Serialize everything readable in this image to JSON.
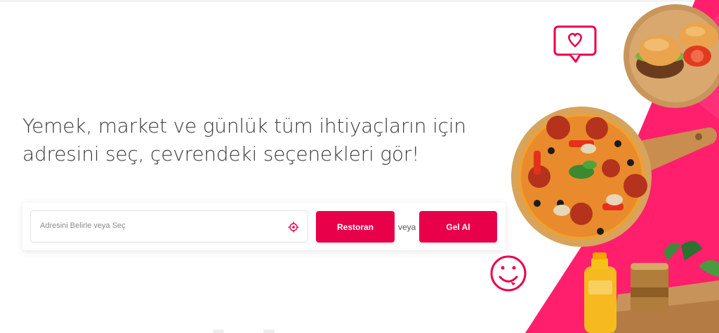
{
  "hero": {
    "headline_line1": "Yemek, market ve günlük tüm ihtiyaçların için",
    "headline_line2": "adresini seç, çevrendeki seçenekleri gör!"
  },
  "search": {
    "placeholder": "Adresini Belirle veya Seç",
    "restoran_label": "Restoran",
    "or_label": "veya",
    "gelal_label": "Gel Al"
  },
  "colors": {
    "accent": "#e8004a",
    "text": "#3a3a3a"
  },
  "icons": [
    "locate-icon",
    "heart-bubble-icon",
    "smiley-icon"
  ]
}
